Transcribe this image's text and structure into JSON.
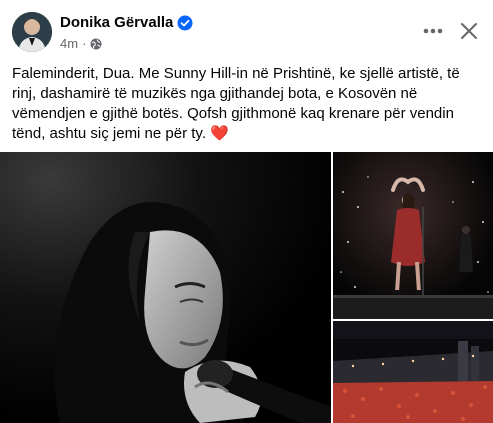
{
  "author": {
    "name": "Donika Gërvalla",
    "verified_icon": "verified-badge-icon",
    "timestamp": "4m",
    "separator": "·",
    "audience_icon": "globe-icon"
  },
  "actions": {
    "more_icon": "more-horizontal-icon",
    "close_icon": "close-icon"
  },
  "post": {
    "text": "Faleminderit, Dua. Me Sunny Hill-in në Prishtinë, ke sjellë artistë, të rinj, dashamirë të muzikës nga gjithandej bota, e Kosovën në vëmendjen e gjithë botës. Qofsh gjithmonë kaq krenare për vendin tënd, ashtu siç jemi ne për ty.",
    "emoji": "❤️"
  },
  "colors": {
    "verified_blue": "#0866ff",
    "secondary_text": "#65676b",
    "heart": "#e0245e",
    "stage_red": "#c0392b"
  }
}
